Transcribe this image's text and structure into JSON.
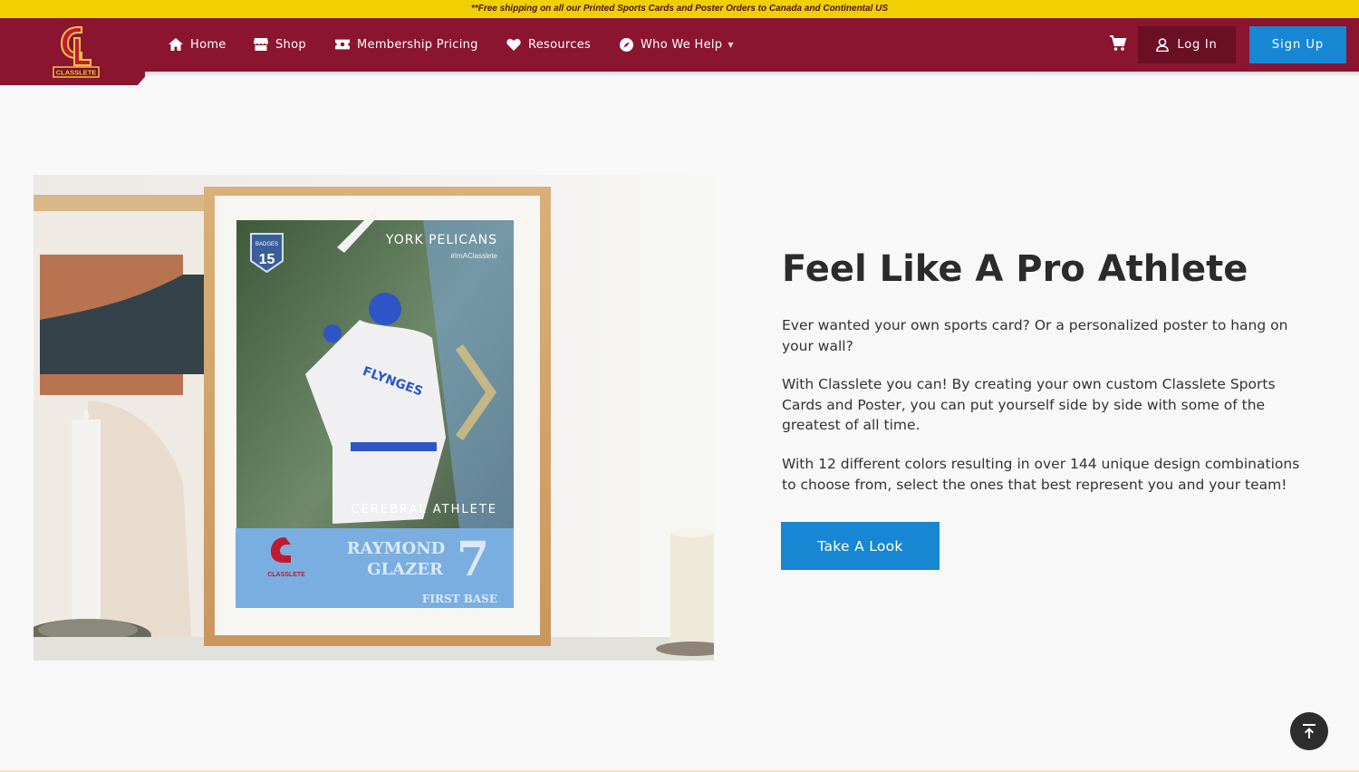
{
  "promo_banner": "**Free shipping on all our Printed Sports Cards and Poster Orders to Canada and Continental US",
  "brand": {
    "name": "CLASSLETE",
    "primary_color": "#8b1530",
    "accent_color": "#1787d3",
    "banner_color": "#f0d000"
  },
  "nav": {
    "items": [
      {
        "label": "Home",
        "icon": "home-icon"
      },
      {
        "label": "Shop",
        "icon": "store-icon"
      },
      {
        "label": "Membership Pricing",
        "icon": "ticket-icon"
      },
      {
        "label": "Resources",
        "icon": "heart-hands-icon"
      },
      {
        "label": "Who We Help",
        "icon": "compass-icon"
      }
    ],
    "login_label": "Log In",
    "signup_label": "Sign Up"
  },
  "hero": {
    "card": {
      "team": "YORK PELICANS",
      "hashtag": "#ImAClasslete",
      "badge_label": "BADGES",
      "badge_count": "15",
      "jersey_text": "FLYNGES",
      "subtitle": "CEREBRAL ATHLETE",
      "player_first": "RAYMOND",
      "player_last": "GLAZER",
      "number": "7",
      "position": "FIRST BASE",
      "logo_text": "CLASSLETE"
    },
    "heading": "Feel Like A Pro Athlete",
    "paragraphs": [
      "Ever wanted your own sports card? Or a personalized poster to hang on your wall?",
      "With Classlete you can! By creating your own custom Classlete Sports Cards and Poster, you can put yourself side by side with some of the greatest of all time.",
      "With 12 different colors resulting in over 144 unique design combinations to choose from, select the ones that best represent you and your team!"
    ],
    "cta_label": "Take A Look"
  }
}
